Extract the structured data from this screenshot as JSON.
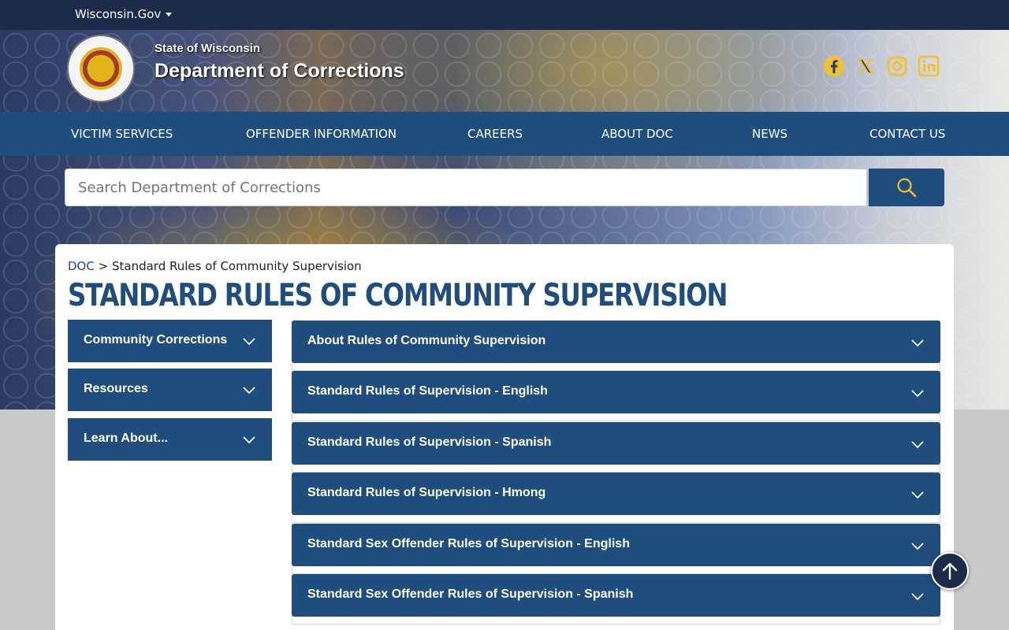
{
  "topbar": {
    "gov_link": "Wisconsin.Gov"
  },
  "header": {
    "state_label": "State of Wisconsin",
    "department": "Department of Corrections",
    "social": [
      {
        "icon": "facebook-icon",
        "color": "#f2c12e"
      },
      {
        "icon": "x-icon",
        "color": "#f2c12e"
      },
      {
        "icon": "instagram-icon",
        "color": "#f2c12e"
      },
      {
        "icon": "linkedin-icon",
        "color": "#f2c12e"
      }
    ]
  },
  "nav": {
    "items": [
      {
        "label": "VICTIM SERVICES"
      },
      {
        "label": "OFFENDER INFORMATION"
      },
      {
        "label": "CAREERS"
      },
      {
        "label": "ABOUT DOC"
      },
      {
        "label": "NEWS"
      },
      {
        "label": "CONTACT US"
      }
    ]
  },
  "search": {
    "placeholder": "Search Department of Corrections"
  },
  "breadcrumb": {
    "home": "DOC",
    "separator": ">",
    "current": "Standard Rules of Community Supervision"
  },
  "page": {
    "title": "STANDARD RULES OF COMMUNITY SUPERVISION"
  },
  "sidebar": {
    "items": [
      {
        "label": "Community Corrections"
      },
      {
        "label": "Resources"
      },
      {
        "label": "Learn About..."
      }
    ]
  },
  "accordions": [
    {
      "label": "About Rules of Community Supervision"
    },
    {
      "label": "Standard Rules of Supervision - English"
    },
    {
      "label": "Standard Rules of Supervision - Spanish"
    },
    {
      "label": "Standard Rules of Supervision - Hmong"
    },
    {
      "label": "Standard Sex Offender Rules of Supervision - English"
    },
    {
      "label": "Standard Sex Offender Rules of Supervision - Spanish"
    }
  ],
  "colors": {
    "brand_navy": "#1e4d7e",
    "topbar": "#1c2b4a",
    "accent_gold": "#f2c12e"
  }
}
